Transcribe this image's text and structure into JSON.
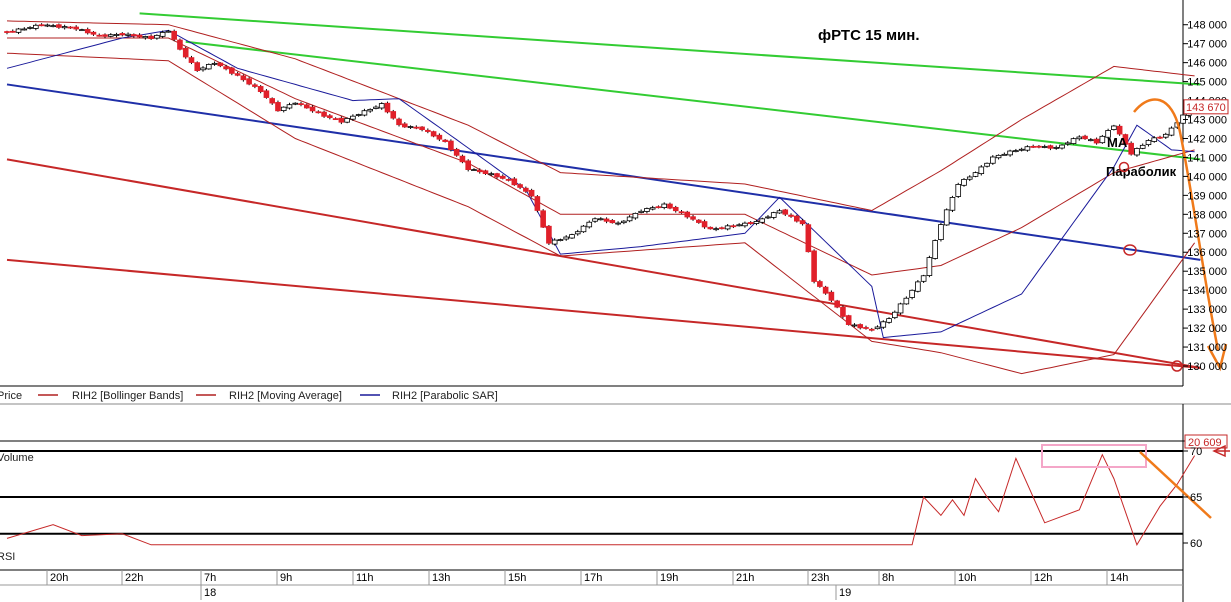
{
  "annotations": {
    "title": "фРТС    15 мин.",
    "ma_label": "MA",
    "parabolic_label": "Параболик",
    "last_price": "143 670",
    "volume_value": "20 609"
  },
  "legend": {
    "price": "Price",
    "bollinger": "RIH2 [Bollinger Bands]",
    "ma": "RIH2 [Moving Average]",
    "sar": "RIH2 [Parabolic SAR]"
  },
  "panels": {
    "volume": "Volume",
    "rsi": "RSI"
  },
  "colors": {
    "up": "#ffffff",
    "down": "#e0202a",
    "bollinger": "#b02020",
    "ma": "#b02020",
    "sar": "#1a1a9a",
    "green_trend": "#33cc33",
    "blue_trend": "#1f2fa8",
    "red_trend": "#c62828",
    "orange_arrow": "#f07a1a",
    "highlight_box": "#f4a6c8"
  },
  "chart_data": [
    {
      "type": "candlestick",
      "name": "RIH2 price",
      "ylim": [
        129300,
        148600
      ],
      "y_ticks": [
        "130 000",
        "131 000",
        "132 000",
        "133 000",
        "134 000",
        "135 000",
        "136 000",
        "137 000",
        "138 000",
        "139 000",
        "140 000",
        "141 000",
        "142 000",
        "143 000",
        "144 000",
        "145 000",
        "146 000",
        "147 000",
        "148 000"
      ],
      "y_tick_values": [
        130000,
        131000,
        132000,
        133000,
        134000,
        135000,
        136000,
        137000,
        138000,
        139000,
        140000,
        141000,
        142000,
        143000,
        144000,
        145000,
        146000,
        147000,
        148000
      ],
      "x_ticks": [
        "20h",
        "22h",
        "7h",
        "9h",
        "11h",
        "13h",
        "15h",
        "17h",
        "19h",
        "21h",
        "23h",
        "8h",
        "10h",
        "12h",
        "14h"
      ],
      "x_day_labels": [
        "18",
        "19"
      ],
      "close_anchors": [
        [
          0,
          147600
        ],
        [
          6,
          148000
        ],
        [
          12,
          147800
        ],
        [
          16,
          147400
        ],
        [
          20,
          147500
        ],
        [
          25,
          147300
        ],
        [
          28,
          147700
        ],
        [
          30,
          146700
        ],
        [
          33,
          145600
        ],
        [
          36,
          146000
        ],
        [
          40,
          145300
        ],
        [
          44,
          144500
        ],
        [
          47,
          143500
        ],
        [
          50,
          143900
        ],
        [
          55,
          143200
        ],
        [
          58,
          142900
        ],
        [
          61,
          143300
        ],
        [
          65,
          143800
        ],
        [
          68,
          142700
        ],
        [
          72,
          142500
        ],
        [
          76,
          141800
        ],
        [
          80,
          140400
        ],
        [
          84,
          140100
        ],
        [
          87,
          139800
        ],
        [
          91,
          139000
        ],
        [
          94,
          136500
        ],
        [
          98,
          136900
        ],
        [
          102,
          137800
        ],
        [
          106,
          137500
        ],
        [
          110,
          138200
        ],
        [
          114,
          138500
        ],
        [
          118,
          137900
        ],
        [
          122,
          137200
        ],
        [
          126,
          137400
        ],
        [
          130,
          137600
        ],
        [
          134,
          138200
        ],
        [
          138,
          137500
        ],
        [
          140,
          134500
        ],
        [
          143,
          133500
        ],
        [
          146,
          132200
        ],
        [
          150,
          131900
        ],
        [
          153,
          132500
        ],
        [
          156,
          133600
        ],
        [
          159,
          134800
        ],
        [
          162,
          137500
        ],
        [
          165,
          139600
        ],
        [
          168,
          140200
        ],
        [
          171,
          141000
        ],
        [
          174,
          141300
        ],
        [
          178,
          141600
        ],
        [
          182,
          141500
        ],
        [
          186,
          142100
        ],
        [
          189,
          141800
        ],
        [
          192,
          142700
        ],
        [
          195,
          141200
        ],
        [
          198,
          141900
        ],
        [
          201,
          142200
        ],
        [
          204,
          143200
        ],
        [
          206,
          143670
        ]
      ],
      "bollinger_upper": [
        [
          0,
          148200
        ],
        [
          28,
          148000
        ],
        [
          50,
          146200
        ],
        [
          80,
          142700
        ],
        [
          96,
          140200
        ],
        [
          128,
          139600
        ],
        [
          150,
          138200
        ],
        [
          162,
          140300
        ],
        [
          176,
          143000
        ],
        [
          192,
          145800
        ],
        [
          206,
          145300
        ]
      ],
      "bollinger_lower": [
        [
          0,
          146500
        ],
        [
          28,
          146100
        ],
        [
          50,
          142000
        ],
        [
          80,
          138400
        ],
        [
          96,
          135800
        ],
        [
          128,
          136500
        ],
        [
          150,
          131300
        ],
        [
          162,
          130700
        ],
        [
          176,
          129600
        ],
        [
          192,
          130600
        ],
        [
          206,
          136500
        ]
      ],
      "moving_average": [
        [
          0,
          147300
        ],
        [
          28,
          147300
        ],
        [
          50,
          144100
        ],
        [
          80,
          140700
        ],
        [
          96,
          138000
        ],
        [
          128,
          138000
        ],
        [
          150,
          134800
        ],
        [
          162,
          135300
        ],
        [
          176,
          137300
        ],
        [
          192,
          140200
        ],
        [
          206,
          141400
        ]
      ],
      "parabolic_sar": [
        [
          0,
          145700
        ],
        [
          20,
          147300
        ],
        [
          28,
          147700
        ],
        [
          40,
          145700
        ],
        [
          60,
          144000
        ],
        [
          68,
          144100
        ],
        [
          80,
          141500
        ],
        [
          90,
          139300
        ],
        [
          96,
          135900
        ],
        [
          110,
          136300
        ],
        [
          128,
          137000
        ],
        [
          134,
          138900
        ],
        [
          150,
          134200
        ],
        [
          152,
          131500
        ],
        [
          162,
          131800
        ],
        [
          176,
          133800
        ],
        [
          192,
          140500
        ],
        [
          196,
          142700
        ],
        [
          202,
          141400
        ],
        [
          206,
          141300
        ]
      ],
      "trend_lines": [
        {
          "color": "green",
          "from": [
            23,
            148600
          ],
          "to": [
            207,
            144850
          ]
        },
        {
          "color": "green",
          "from": [
            31,
            147100
          ],
          "to": [
            207,
            140900
          ]
        },
        {
          "color": "blue",
          "from": [
            0,
            144850
          ],
          "to": [
            207,
            135600
          ]
        },
        {
          "color": "red",
          "from": [
            0,
            140900
          ],
          "to": [
            207,
            129900
          ]
        },
        {
          "color": "red",
          "from": [
            0,
            135600
          ],
          "to": [
            207,
            129900
          ]
        }
      ]
    },
    {
      "type": "line",
      "name": "RSI",
      "ylim": [
        59.3,
        71.4
      ],
      "y_ticks": [
        "60",
        "65",
        "70"
      ],
      "y_tick_values": [
        60,
        65,
        70
      ],
      "reference_lines": [
        70,
        65,
        61
      ],
      "values": [
        [
          0,
          60.5
        ],
        [
          8,
          62
        ],
        [
          13,
          60.8
        ],
        [
          20,
          61
        ],
        [
          25,
          59.8
        ],
        [
          157,
          59.8
        ],
        [
          159,
          65
        ],
        [
          162,
          63
        ],
        [
          164,
          64.7
        ],
        [
          166,
          63
        ],
        [
          168,
          67
        ],
        [
          170,
          65
        ],
        [
          172,
          63.4
        ],
        [
          175,
          69.2
        ],
        [
          180,
          62.2
        ],
        [
          186,
          63.6
        ],
        [
          190,
          69.6
        ],
        [
          192,
          67
        ],
        [
          196,
          59.8
        ],
        [
          200,
          64
        ],
        [
          203,
          66.4
        ],
        [
          206,
          69.5
        ]
      ]
    }
  ]
}
